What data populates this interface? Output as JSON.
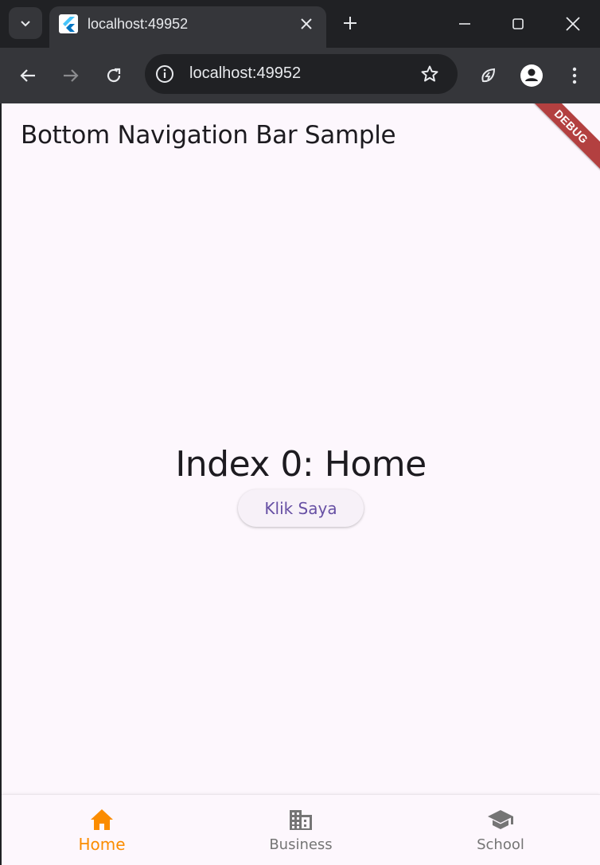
{
  "browser": {
    "tab_title": "localhost:49952",
    "url": "localhost:49952"
  },
  "app": {
    "title": "Bottom Navigation Bar Sample",
    "debug_banner": "DEBUG",
    "content_label": "Index 0: Home",
    "button_label": "Klik Saya"
  },
  "bottom_nav": {
    "items": [
      {
        "label": "Home",
        "icon": "home-icon",
        "active": true
      },
      {
        "label": "Business",
        "icon": "business-icon",
        "active": false
      },
      {
        "label": "School",
        "icon": "school-icon",
        "active": false
      }
    ],
    "active_color": "#fb8c00",
    "inactive_color": "#757575"
  }
}
